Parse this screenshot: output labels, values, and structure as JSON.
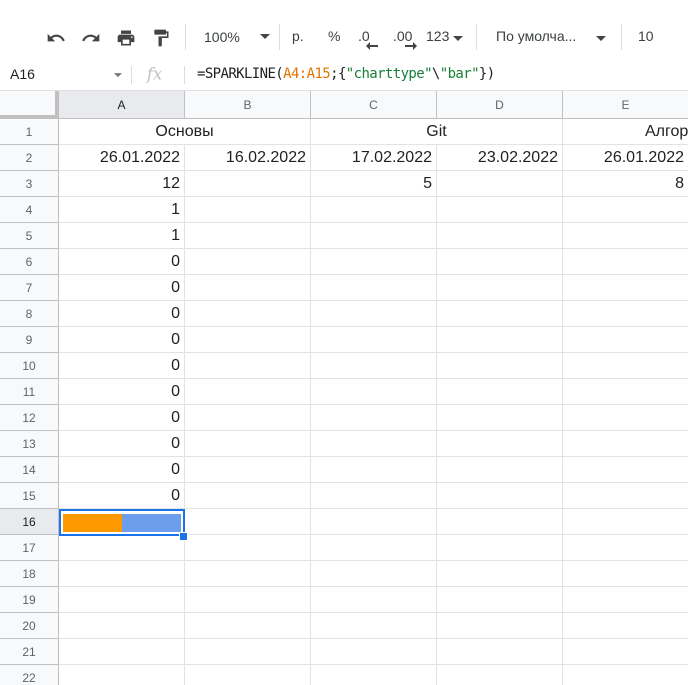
{
  "toolbar": {
    "zoom": "100%",
    "currency": "р.",
    "percent": "%",
    "decrease_decimals": ".0",
    "increase_decimals": ".00",
    "more_formats": "123",
    "font_name": "По умолча...",
    "font_size": "10"
  },
  "formula_bar": {
    "name_box": "A16",
    "formula_prefix": "=SPARKLINE(",
    "formula_range": "A4:A15",
    "formula_sep": ";{",
    "formula_key": "\"charttype\"",
    "formula_bs": "\\",
    "formula_val": "\"bar\"",
    "formula_suffix": "})"
  },
  "columns": [
    "A",
    "B",
    "C",
    "D",
    "E"
  ],
  "rows": [
    "1",
    "2",
    "3",
    "4",
    "5",
    "6",
    "7",
    "8",
    "9",
    "10",
    "11",
    "12",
    "13",
    "14",
    "15",
    "16",
    "17",
    "18",
    "19",
    "20",
    "21",
    "22"
  ],
  "cells": {
    "A1": "Основы",
    "C1": "Git",
    "E1": "Алгор",
    "A2": "26.01.2022",
    "B2": "16.02.2022",
    "C2": "17.02.2022",
    "D2": "23.02.2022",
    "E2": "26.01.2022",
    "A3": "12",
    "C3": "5",
    "E3": "8",
    "A4": "1",
    "A5": "1",
    "A6": "0",
    "A7": "0",
    "A8": "0",
    "A9": "0",
    "A10": "0",
    "A11": "0",
    "A12": "0",
    "A13": "0",
    "A14": "0",
    "A15": "0"
  },
  "sparkline": {
    "cell": "A16",
    "type": "bar",
    "values": [
      1,
      1
    ],
    "colors": [
      "#ff9900",
      "#6d9eeb"
    ]
  }
}
